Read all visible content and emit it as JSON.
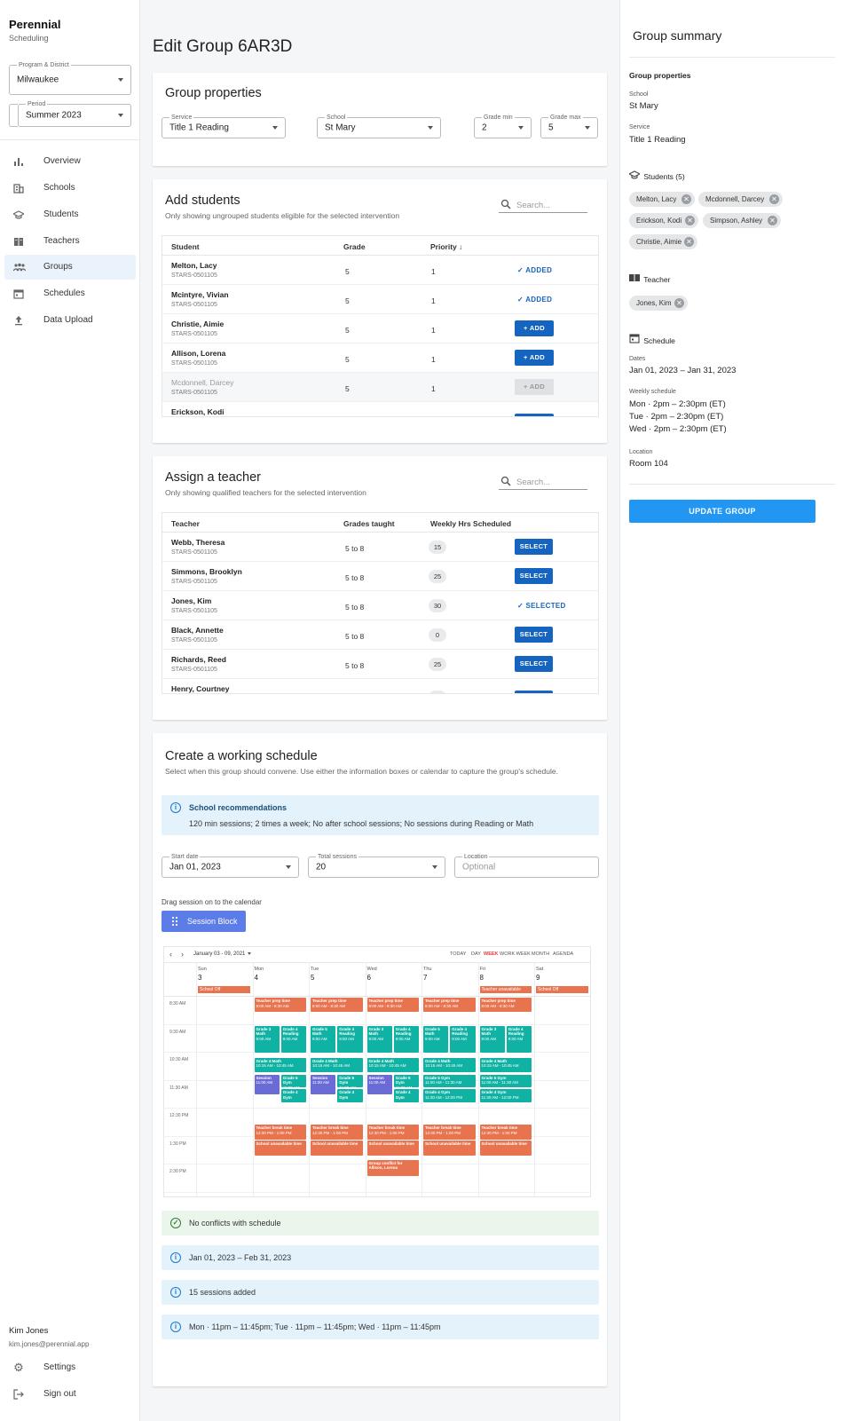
{
  "app": {
    "name": "Perennial",
    "subtitle": "Scheduling"
  },
  "sidebar": {
    "program": {
      "label": "Program & District",
      "value": "Milwaukee"
    },
    "period": {
      "label": "Period",
      "value": "Summer 2023"
    },
    "items": [
      {
        "label": "Overview",
        "icon": "bar-chart-icon"
      },
      {
        "label": "Schools",
        "icon": "building-icon"
      },
      {
        "label": "Students",
        "icon": "graduation-cap-icon"
      },
      {
        "label": "Teachers",
        "icon": "book-icon"
      },
      {
        "label": "Groups",
        "icon": "group-icon",
        "active": true
      },
      {
        "label": "Schedules",
        "icon": "calendar-icon"
      },
      {
        "label": "Data Upload",
        "icon": "upload-icon"
      }
    ],
    "user": {
      "name": "Kim Jones",
      "email": "kim.jones@perennial.app"
    },
    "settings": "Settings",
    "signout": "Sign out"
  },
  "page": {
    "title": "Edit Group 6AR3D"
  },
  "group_properties": {
    "title": "Group properties",
    "service": {
      "label": "Service",
      "value": "Title 1 Reading"
    },
    "school": {
      "label": "School",
      "value": "St Mary"
    },
    "grade_min": {
      "label": "Grade min",
      "value": "2"
    },
    "grade_max": {
      "label": "Grade max",
      "value": "5"
    }
  },
  "add_students": {
    "title": "Add students",
    "subtitle": "Only showing ungrouped students eligible for the selected intervention",
    "search_placeholder": "Search...",
    "columns": {
      "student": "Student",
      "grade": "Grade",
      "priority": "Priority ↓"
    },
    "rows": [
      {
        "name": "Melton, Lacy",
        "id": "STARS-0501105",
        "grade": "5",
        "priority": "1",
        "action": "✓ ADDED",
        "state": "added"
      },
      {
        "name": "Mcintyre, Vivian",
        "id": "STARS-0501105",
        "grade": "5",
        "priority": "1",
        "action": "✓ ADDED",
        "state": "added"
      },
      {
        "name": "Christie, Aimie",
        "id": "STARS-0501105",
        "grade": "5",
        "priority": "1",
        "action": "+ ADD",
        "state": "add"
      },
      {
        "name": "Allison, Lorena",
        "id": "STARS-0501105",
        "grade": "5",
        "priority": "1",
        "action": "+ ADD",
        "state": "add"
      },
      {
        "name": "Mcdonnell, Darcey",
        "id": "STARS-0501105",
        "grade": "5",
        "priority": "1",
        "action": "+ ADD",
        "state": "disabled"
      },
      {
        "name": "Erickson, Kodi",
        "id": "",
        "grade": "",
        "priority": "",
        "action": "",
        "state": "add"
      }
    ]
  },
  "assign_teacher": {
    "title": "Assign a teacher",
    "subtitle": "Only showing qualified teachers for the selected intervention",
    "search_placeholder": "Search...",
    "columns": {
      "teacher": "Teacher",
      "grades": "Grades taught",
      "hours": "Weekly Hrs Scheduled"
    },
    "rows": [
      {
        "name": "Webb, Theresa",
        "id": "STARS-0501105",
        "grades": "5 to 8",
        "hours": "15",
        "action": "SELECT",
        "state": "select"
      },
      {
        "name": "Simmons, Brooklyn",
        "id": "STARS-0501105",
        "grades": "5 to 8",
        "hours": "25",
        "action": "SELECT",
        "state": "select"
      },
      {
        "name": "Jones, Kim",
        "id": "STARS-0501105",
        "grades": "5 to 8",
        "hours": "30",
        "action": "✓ SELECTED",
        "state": "selected"
      },
      {
        "name": "Black, Annette",
        "id": "STARS-0501105",
        "grades": "5 to 8",
        "hours": "0",
        "action": "SELECT",
        "state": "select"
      },
      {
        "name": "Richards, Reed",
        "id": "STARS-0501105",
        "grades": "5 to 8",
        "hours": "25",
        "action": "SELECT",
        "state": "select"
      },
      {
        "name": "Henry, Courtney",
        "id": "",
        "grades": "",
        "hours": "",
        "action": "",
        "state": "select"
      }
    ]
  },
  "schedule": {
    "title": "Create a working schedule",
    "subtitle": "Select when this group should convene. Use either the information boxes or calendar to capture the group's schedule.",
    "recommendation_title": "School recommendations",
    "recommendation_text": "120 min sessions; 2 times a week; No after school sessions; No sessions during Reading or Math",
    "start_date": {
      "label": "Start date",
      "value": "Jan 01, 2023"
    },
    "total_sessions": {
      "label": "Total sessions",
      "value": "20"
    },
    "location": {
      "label": "Location",
      "placeholder": "Optional"
    },
    "drag_hint": "Drag session on to the calendar",
    "session_block": "Session Block",
    "statuses": [
      {
        "type": "success",
        "text": "No conflicts with schedule"
      },
      {
        "type": "info",
        "text": "Jan 01, 2023 – Feb 31, 2023"
      },
      {
        "type": "info",
        "text": "15 sessions added"
      },
      {
        "type": "info",
        "text": "Mon · 11pm – 11:45pm; Tue · 11pm – 11:45pm; Wed · 11pm – 11:45pm"
      }
    ]
  },
  "calendar": {
    "range_label": "January 03 - 09, 2021",
    "views": [
      "TODAY",
      "DAY",
      "WEEK",
      "WORK WEEK",
      "MONTH",
      "AGENDA"
    ],
    "active_view": "WEEK",
    "days": [
      {
        "dow": "Sun",
        "date": "3"
      },
      {
        "dow": "Mon",
        "date": "4"
      },
      {
        "dow": "Tue",
        "date": "5"
      },
      {
        "dow": "Wed",
        "date": "6"
      },
      {
        "dow": "Thu",
        "date": "7"
      },
      {
        "dow": "Fri",
        "date": "8"
      },
      {
        "dow": "Sat",
        "date": "9"
      }
    ],
    "times": [
      "8:30 AM",
      "9:30 AM",
      "10:30 AM",
      "11:30 AM",
      "12:30 PM",
      "1:30 PM",
      "2:30 PM"
    ],
    "allday": [
      {
        "day": 0,
        "text": "School Off"
      },
      {
        "day": 5,
        "text": "Teacher unavailable"
      },
      {
        "day": 6,
        "text": "School Off"
      }
    ],
    "colors": {
      "orange": "#e8734f",
      "teal": "#10b3a3",
      "purple": "#6b6bd8"
    },
    "events": [
      {
        "day": 1,
        "slot": 0,
        "start": 0,
        "len": 0.55,
        "col": 0,
        "cols": 1,
        "text": "Teacher prep time",
        "sub": "8:00 AM - 8:30 AM",
        "color": "orange"
      },
      {
        "day": 2,
        "slot": 0,
        "start": 0,
        "len": 0.55,
        "col": 0,
        "cols": 1,
        "text": "Teacher prep time",
        "sub": "8:00 AM - 8:30 AM",
        "color": "orange"
      },
      {
        "day": 3,
        "slot": 0,
        "start": 0,
        "len": 0.55,
        "col": 0,
        "cols": 1,
        "text": "Teacher prep time",
        "sub": "8:00 AM - 8:30 AM",
        "color": "orange"
      },
      {
        "day": 4,
        "slot": 0,
        "start": 0,
        "len": 0.55,
        "col": 0,
        "cols": 1,
        "text": "Teacher prep time",
        "sub": "8:00 AM - 8:30 AM",
        "color": "orange"
      },
      {
        "day": 5,
        "slot": 0,
        "start": 0,
        "len": 0.55,
        "col": 0,
        "cols": 1,
        "text": "Teacher prep time",
        "sub": "8:00 AM - 8:30 AM",
        "color": "orange"
      },
      {
        "day": 1,
        "slot": 1,
        "start": 0,
        "len": 1,
        "col": 0,
        "cols": 2,
        "text": "Grade 3 Math",
        "sub": "9:00 AM",
        "color": "teal"
      },
      {
        "day": 1,
        "slot": 1,
        "start": 0,
        "len": 1,
        "col": 1,
        "cols": 2,
        "text": "Grade 4 Reading",
        "sub": "9:00 AM",
        "color": "teal"
      },
      {
        "day": 2,
        "slot": 1,
        "start": 0,
        "len": 1,
        "col": 0,
        "cols": 2,
        "text": "Grade 5 Math",
        "sub": "9:00 AM",
        "color": "teal"
      },
      {
        "day": 2,
        "slot": 1,
        "start": 0,
        "len": 1,
        "col": 1,
        "cols": 2,
        "text": "Grade 4 Reading",
        "sub": "9:00 AM",
        "color": "teal"
      },
      {
        "day": 3,
        "slot": 1,
        "start": 0,
        "len": 1,
        "col": 0,
        "cols": 2,
        "text": "Grade 3 Math",
        "sub": "9:00 AM",
        "color": "teal"
      },
      {
        "day": 3,
        "slot": 1,
        "start": 0,
        "len": 1,
        "col": 1,
        "cols": 2,
        "text": "Grade 4 Reading",
        "sub": "9:00 AM",
        "color": "teal"
      },
      {
        "day": 4,
        "slot": 1,
        "start": 0,
        "len": 1,
        "col": 0,
        "cols": 2,
        "text": "Grade 5 Math",
        "sub": "9:00 AM",
        "color": "teal"
      },
      {
        "day": 4,
        "slot": 1,
        "start": 0,
        "len": 1,
        "col": 1,
        "cols": 2,
        "text": "Grade 4 Reading",
        "sub": "9:00 AM",
        "color": "teal"
      },
      {
        "day": 5,
        "slot": 1,
        "start": 0,
        "len": 1,
        "col": 0,
        "cols": 2,
        "text": "Grade 3 Math",
        "sub": "9:00 AM",
        "color": "teal"
      },
      {
        "day": 5,
        "slot": 1,
        "start": 0,
        "len": 1,
        "col": 1,
        "cols": 2,
        "text": "Grade 4 Reading",
        "sub": "9:00 AM",
        "color": "teal"
      },
      {
        "day": 1,
        "slot": 2,
        "start": 0.15,
        "len": 0.55,
        "col": 0,
        "cols": 1,
        "text": "Grade 4 Math",
        "sub": "10:15 AM - 10:45 AM",
        "color": "teal"
      },
      {
        "day": 2,
        "slot": 2,
        "start": 0.15,
        "len": 0.55,
        "col": 0,
        "cols": 1,
        "text": "Grade 4 Math",
        "sub": "10:15 AM - 10:45 AM",
        "color": "teal"
      },
      {
        "day": 3,
        "slot": 2,
        "start": 0.15,
        "len": 0.55,
        "col": 0,
        "cols": 1,
        "text": "Grade 4 Math",
        "sub": "10:15 AM - 10:45 AM",
        "color": "teal"
      },
      {
        "day": 4,
        "slot": 2,
        "start": 0.15,
        "len": 0.55,
        "col": 0,
        "cols": 1,
        "text": "Grade 4 Math",
        "sub": "10:15 AM - 10:45 AM",
        "color": "teal"
      },
      {
        "day": 5,
        "slot": 2,
        "start": 0.15,
        "len": 0.55,
        "col": 0,
        "cols": 1,
        "text": "Grade 4 Math",
        "sub": "10:15 AM - 10:45 AM",
        "color": "teal"
      },
      {
        "day": 1,
        "slot": 3,
        "start": -0.25,
        "len": 0.75,
        "col": 0,
        "cols": 2,
        "text": "Session",
        "sub": "11:00 AM",
        "color": "purple"
      },
      {
        "day": 1,
        "slot": 3,
        "start": -0.25,
        "len": 0.5,
        "col": 1,
        "cols": 2,
        "text": "Grade 5 Gym",
        "sub": "11:00 AM",
        "color": "teal"
      },
      {
        "day": 1,
        "slot": 3,
        "start": 0.27,
        "len": 0.5,
        "col": 1,
        "cols": 2,
        "text": "Grade 4 Gym",
        "sub": "",
        "color": "teal"
      },
      {
        "day": 2,
        "slot": 3,
        "start": -0.25,
        "len": 0.75,
        "col": 0,
        "cols": 2,
        "text": "Session",
        "sub": "11:00 AM",
        "color": "purple"
      },
      {
        "day": 2,
        "slot": 3,
        "start": -0.25,
        "len": 0.5,
        "col": 1,
        "cols": 2,
        "text": "Grade 5 Gym",
        "sub": "11:00 AM",
        "color": "teal"
      },
      {
        "day": 2,
        "slot": 3,
        "start": 0.27,
        "len": 0.5,
        "col": 1,
        "cols": 2,
        "text": "Grade 4 Gym",
        "sub": "",
        "color": "teal"
      },
      {
        "day": 3,
        "slot": 3,
        "start": -0.25,
        "len": 0.75,
        "col": 0,
        "cols": 2,
        "text": "Session",
        "sub": "11:00 AM",
        "color": "purple"
      },
      {
        "day": 3,
        "slot": 3,
        "start": -0.25,
        "len": 0.5,
        "col": 1,
        "cols": 2,
        "text": "Grade 5 Gym",
        "sub": "11:00 AM",
        "color": "teal"
      },
      {
        "day": 3,
        "slot": 3,
        "start": 0.27,
        "len": 0.5,
        "col": 1,
        "cols": 2,
        "text": "Grade 4 Gym",
        "sub": "",
        "color": "teal"
      },
      {
        "day": 4,
        "slot": 3,
        "start": -0.25,
        "len": 0.5,
        "col": 0,
        "cols": 1,
        "text": "Grade 5 Gym",
        "sub": "11:00 AM - 11:30 AM",
        "color": "teal"
      },
      {
        "day": 4,
        "slot": 3,
        "start": 0.27,
        "len": 0.5,
        "col": 0,
        "cols": 1,
        "text": "Grade 4 Gym",
        "sub": "11:30 AM - 12:00 PM",
        "color": "teal"
      },
      {
        "day": 5,
        "slot": 3,
        "start": -0.25,
        "len": 0.5,
        "col": 0,
        "cols": 1,
        "text": "Grade 5 Gym",
        "sub": "11:00 AM - 11:30 AM",
        "color": "teal"
      },
      {
        "day": 5,
        "slot": 3,
        "start": 0.27,
        "len": 0.5,
        "col": 0,
        "cols": 1,
        "text": "Grade 4 Gym",
        "sub": "11:30 AM - 12:00 PM",
        "color": "teal"
      },
      {
        "day": 1,
        "slot": 4,
        "start": 0.55,
        "len": 0.55,
        "col": 0,
        "cols": 1,
        "text": "Teacher break time",
        "sub": "12:30 PM - 1:00 PM",
        "color": "orange"
      },
      {
        "day": 2,
        "slot": 4,
        "start": 0.55,
        "len": 0.55,
        "col": 0,
        "cols": 1,
        "text": "Teacher break time",
        "sub": "12:30 PM - 1:00 PM",
        "color": "orange"
      },
      {
        "day": 3,
        "slot": 4,
        "start": 0.55,
        "len": 0.55,
        "col": 0,
        "cols": 1,
        "text": "Teacher break time",
        "sub": "12:30 PM - 1:00 PM",
        "color": "orange"
      },
      {
        "day": 4,
        "slot": 4,
        "start": 0.55,
        "len": 0.55,
        "col": 0,
        "cols": 1,
        "text": "Teacher break time",
        "sub": "12:30 PM - 1:00 PM",
        "color": "orange"
      },
      {
        "day": 5,
        "slot": 4,
        "start": 0.55,
        "len": 0.55,
        "col": 0,
        "cols": 1,
        "text": "Teacher break time",
        "sub": "12:30 PM - 1:00 PM",
        "color": "orange"
      },
      {
        "day": 1,
        "slot": 5,
        "start": 0.12,
        "len": 0.55,
        "col": 0,
        "cols": 1,
        "text": "School unavailable time",
        "sub": "",
        "color": "orange"
      },
      {
        "day": 2,
        "slot": 5,
        "start": 0.12,
        "len": 0.55,
        "col": 0,
        "cols": 1,
        "text": "School unavailable time",
        "sub": "",
        "color": "orange"
      },
      {
        "day": 3,
        "slot": 5,
        "start": 0.12,
        "len": 0.55,
        "col": 0,
        "cols": 1,
        "text": "School unavailable time",
        "sub": "",
        "color": "orange"
      },
      {
        "day": 4,
        "slot": 5,
        "start": 0.12,
        "len": 0.55,
        "col": 0,
        "cols": 1,
        "text": "School unavailable time",
        "sub": "",
        "color": "orange"
      },
      {
        "day": 5,
        "slot": 5,
        "start": 0.12,
        "len": 0.55,
        "col": 0,
        "cols": 1,
        "text": "School unavailable time",
        "sub": "",
        "color": "orange"
      },
      {
        "day": 3,
        "slot": 6,
        "start": -0.2,
        "len": 0.6,
        "col": 0,
        "cols": 1,
        "text": "Group conflict for Allison, Lorena",
        "sub": "",
        "color": "orange"
      }
    ]
  },
  "summary": {
    "title": "Group summary",
    "properties_title": "Group properties",
    "school_label": "School",
    "school": "St Mary",
    "service_label": "Service",
    "service": "Title 1 Reading",
    "students_title": "Students (5)",
    "students": [
      "Melton, Lacy",
      "Mcdonnell, Darcey",
      "Erickson, Kodi",
      "Simpson, Ashley",
      "Christie, Aimie"
    ],
    "teacher_title": "Teacher",
    "teacher": "Jones, Kim",
    "schedule_title": "Schedule",
    "dates_label": "Dates",
    "dates": "Jan 01, 2023 – Jan 31, 2023",
    "weekly_label": "Weekly schedule",
    "weekly": [
      "Mon · 2pm – 2:30pm (ET)",
      "Tue · 2pm – 2:30pm (ET)",
      "Wed · 2pm – 2:30pm (ET)"
    ],
    "location_label": "Location",
    "location": "Room 104",
    "update_button": "UPDATE GROUP"
  }
}
